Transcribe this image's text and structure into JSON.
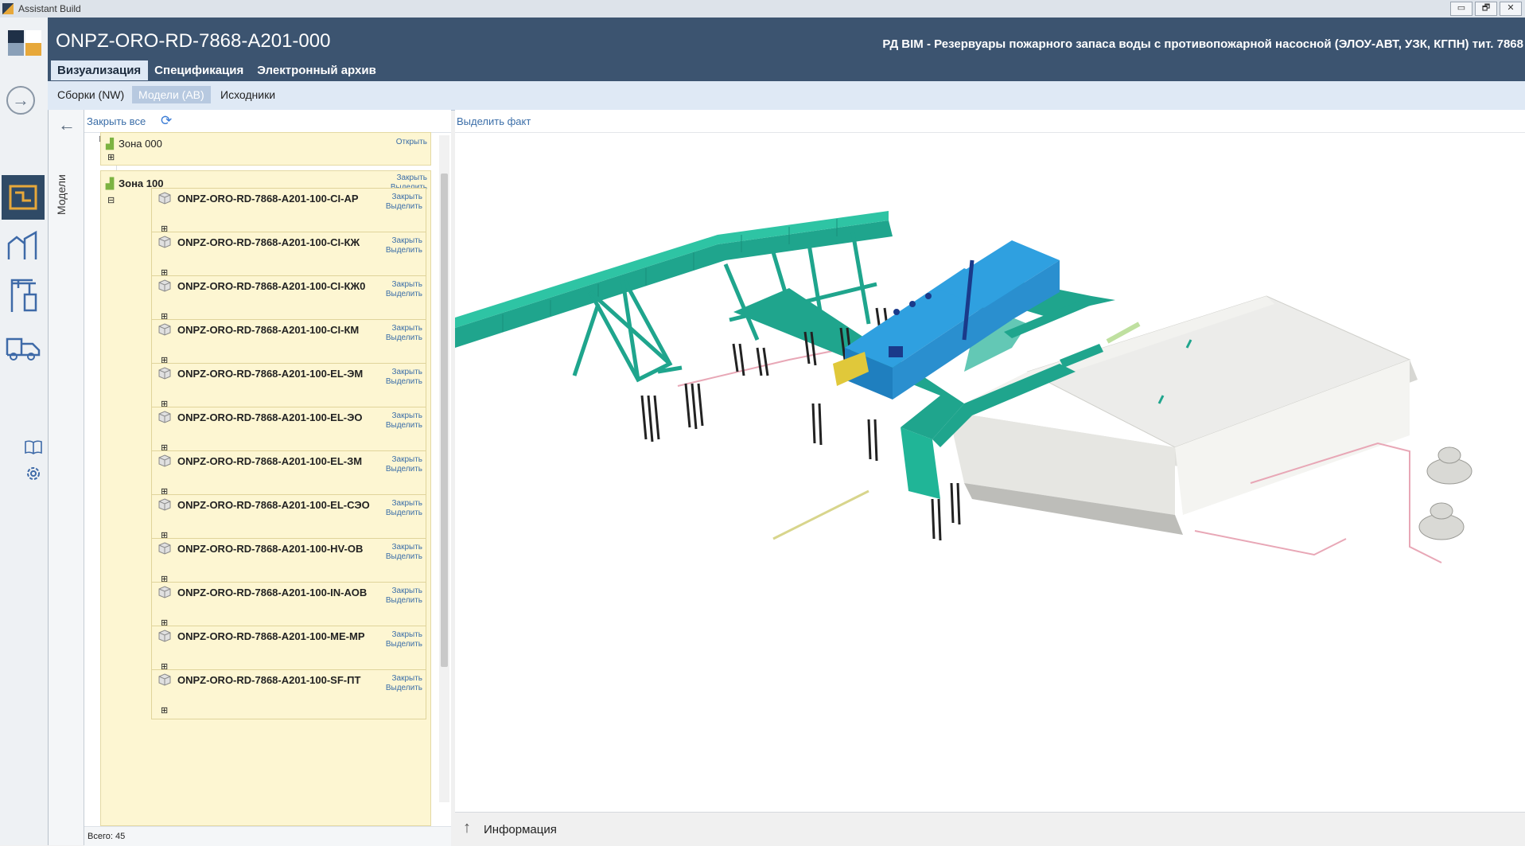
{
  "window": {
    "title": "Assistant Build",
    "buttons": [
      "▭",
      "🗗",
      "✕"
    ]
  },
  "header": {
    "doc_title": "ONPZ-ORO-RD-7868-A201-000",
    "doc_subtitle": "РД BIM - Резервуары пожарного запаса воды с противопожарной насосной (ЭЛОУ-АВТ, УЗК, КГПН) тит. 7868"
  },
  "tabs": [
    "Визуализация",
    "Спецификация",
    "Электронный архив"
  ],
  "subtabs": [
    "Сборки (NW)",
    "Модели (AB)",
    "Исходники"
  ],
  "side_label": "Модели",
  "tree": {
    "close_all": "Закрыть все",
    "zone0": {
      "label": "Зона 000",
      "action": "Открыть"
    },
    "zone1": {
      "label": "Зона 100",
      "actions": [
        "Закрыть",
        "Выделить"
      ]
    },
    "item_actions": [
      "Закрыть",
      "Выделить"
    ],
    "items": [
      "ONPZ-ORO-RD-7868-A201-100-CI-AP",
      "ONPZ-ORO-RD-7868-A201-100-CI-КЖ",
      "ONPZ-ORO-RD-7868-A201-100-CI-КЖ0",
      "ONPZ-ORO-RD-7868-A201-100-CI-КМ",
      "ONPZ-ORO-RD-7868-A201-100-EL-ЭМ",
      "ONPZ-ORO-RD-7868-A201-100-EL-ЭО",
      "ONPZ-ORO-RD-7868-A201-100-EL-ЗМ",
      "ONPZ-ORO-RD-7868-A201-100-EL-СЭО",
      "ONPZ-ORO-RD-7868-A201-100-HV-ОВ",
      "ONPZ-ORO-RD-7868-A201-100-IN-АОВ",
      "ONPZ-ORO-RD-7868-A201-100-ME-МР",
      "ONPZ-ORO-RD-7868-A201-100-SF-ПТ"
    ],
    "count": "Всего: 45"
  },
  "viewport": {
    "highlight_fact": "Выделить факт"
  },
  "info_label": "Информация",
  "colors": {
    "header": "#3c5470",
    "subtab_bg": "#dfe9f5",
    "item_bg": "#fdf6d2",
    "structure": "#1fa58d",
    "building": "#2fa0e0"
  }
}
